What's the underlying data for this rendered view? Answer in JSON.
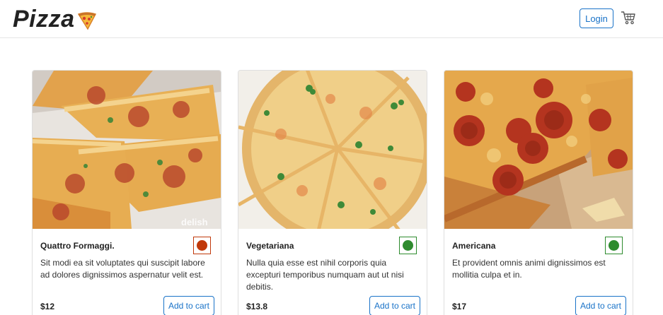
{
  "header": {
    "brand": "Pizza",
    "brand_icon": "pizza-slice-icon",
    "login_label": "Login",
    "cart_icon": "shopping-cart-icon",
    "accent": "#1a73c8"
  },
  "products": [
    {
      "name": "Quattro Formaggi.",
      "description": "Sit modi ea sit voluptates qui suscipit labore ad dolores dignissimos aspernatur velit est.",
      "price": "$12",
      "add_label": "Add to cart",
      "image_watermark": "delish",
      "diet": "non-veg",
      "diet_color": "#c0390b"
    },
    {
      "name": "Vegetariana",
      "description": "Nulla quia esse est nihil corporis quia excepturi temporibus numquam aut ut nisi debitis.",
      "price": "$13.8",
      "add_label": "Add to cart",
      "diet": "veg",
      "diet_color": "#2e8b2e"
    },
    {
      "name": "Americana",
      "description": "Et provident omnis animi dignissimos est mollitia culpa et in.",
      "price": "$17",
      "add_label": "Add to cart",
      "diet": "veg",
      "diet_color": "#2e8b2e"
    }
  ]
}
